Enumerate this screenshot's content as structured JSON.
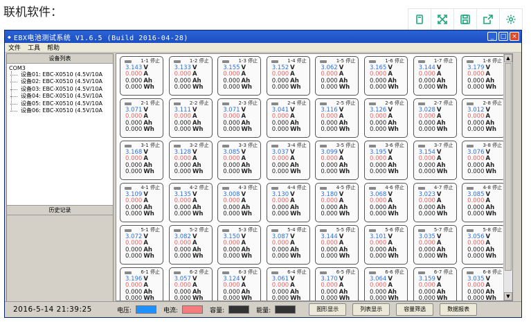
{
  "page": {
    "heading": "联机软件："
  },
  "top_actions": [
    {
      "icon": "copy-icon"
    },
    {
      "icon": "expand-icon"
    },
    {
      "icon": "save-icon"
    },
    {
      "icon": "share-icon"
    },
    {
      "icon": "gear-icon"
    }
  ],
  "window": {
    "title": "EBX电池测试系统 V1.6.5 (Build 2016-04-28)",
    "buttons": {
      "minimize": "_",
      "maximize": "□",
      "close": "×"
    }
  },
  "menu": [
    "文件",
    "工具",
    "帮助"
  ],
  "left_panel": {
    "device_list_header": "设备列表",
    "root": "COM3",
    "devices": [
      "设备01: EBC-X0510 (4.5V/10A",
      "设备02: EBC-X0510 (4.5V/10A",
      "设备03: EBC-X0510 (4.5V/10A",
      "设备04: EBC-X0510 (4.5V/10A",
      "设备05: EBC-X0510 (4.5V/10A",
      "设备06: EBC-X0510 (4.5V/10A"
    ],
    "history_header": "历史记录"
  },
  "channels": {
    "status": "停止",
    "current": "0.000",
    "capacity": "0.000",
    "energy": "0.000",
    "units": {
      "v": "V",
      "a": "A",
      "ah": "Ah",
      "wh": "Wh"
    },
    "rows": [
      {
        "ids": [
          "1-1",
          "1-2",
          "1-3",
          "1-4",
          "1-5",
          "1-6",
          "1-7",
          "1-8"
        ],
        "voltages": [
          "3.143",
          "3.133",
          "3.155",
          "3.152",
          "3.062",
          "3.165",
          "3.144",
          "3.179"
        ]
      },
      {
        "ids": [
          "2-1",
          "2-2",
          "2-3",
          "2-4",
          "2-5",
          "2-6",
          "2-7",
          "2-8"
        ],
        "voltages": [
          "3.071",
          "3.111",
          "3.071",
          "3.041",
          "3.116",
          "3.126",
          "3.028",
          "3.012"
        ]
      },
      {
        "ids": [
          "3-1",
          "3-2",
          "3-3",
          "3-4",
          "3-5",
          "3-6",
          "3-7",
          "3-8"
        ],
        "voltages": [
          "3.168",
          "3.128",
          "3.085",
          "3.037",
          "3.099",
          "3.195",
          "3.154",
          "3.076"
        ]
      },
      {
        "ids": [
          "4-1",
          "4-2",
          "4-3",
          "4-4",
          "4-5",
          "4-6",
          "4-7",
          "4-8"
        ],
        "voltages": [
          "3.109",
          "3.135",
          "3.008",
          "3.130",
          "3.180",
          "3.068",
          "3.023",
          "3.085"
        ]
      },
      {
        "ids": [
          "5-1",
          "5-2",
          "5-3",
          "5-4",
          "5-5",
          "5-6",
          "5-7",
          "5-8"
        ],
        "voltages": [
          "3.072",
          "3.082",
          "3.150",
          "3.087",
          "3.144",
          "3.101",
          "3.035",
          "3.056"
        ]
      },
      {
        "ids": [
          "6-1",
          "6-2",
          "6-3",
          "6-4",
          "6-5",
          "6-6",
          "6-7",
          "6-8"
        ],
        "voltages": [
          "3.196",
          "3.057",
          "3.124",
          "3.061",
          "3.170",
          "3.064",
          "3.159",
          "3.035"
        ]
      }
    ]
  },
  "statusbar": {
    "datetime": "2016-5-14  21:39:25",
    "legend": [
      {
        "label": "电压:",
        "color": "#1e90ff"
      },
      {
        "label": "电流:",
        "color": "#f47c7c"
      },
      {
        "label": "容量:",
        "color": "#333333"
      },
      {
        "label": "能量:",
        "color": "#333333"
      }
    ],
    "buttons": [
      "图形显示",
      "列表显示",
      "容量筛选",
      "数据报表"
    ]
  }
}
